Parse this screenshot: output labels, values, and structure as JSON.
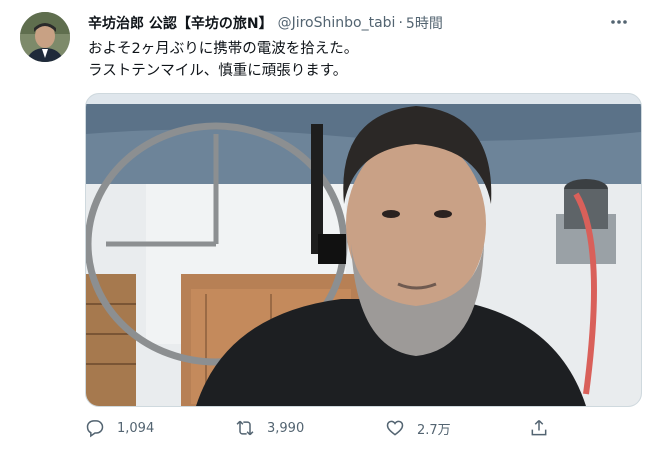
{
  "tweet": {
    "author_name": "辛坊治郎 公認【辛坊の旅N】",
    "author_handle": "@JiroShinbo_tabi",
    "separator": "·",
    "time": "5時間",
    "text_lines": [
      "およそ2ヶ月ぶりに携帯の電波を拾えた。",
      "ラストテンマイル、慎重に頑張ります。"
    ]
  },
  "actions": {
    "reply_count": "1,094",
    "retweet_count": "3,990",
    "like_count": "2.7万"
  },
  "icons": {
    "more": "more-icon",
    "reply": "reply-icon",
    "retweet": "retweet-icon",
    "like": "like-icon",
    "share": "share-icon"
  },
  "colors": {
    "text": "#0f1419",
    "secondary": "#536471",
    "border": "#cfd9de"
  }
}
